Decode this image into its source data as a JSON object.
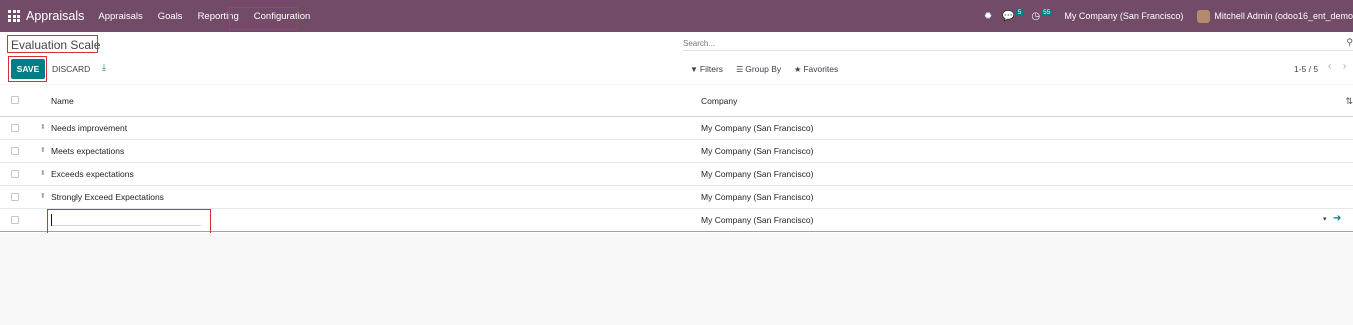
{
  "navbar": {
    "app_name": "Appraisals",
    "menu": [
      "Appraisals",
      "Goals",
      "Reporting",
      "Configuration"
    ],
    "messages_badge": "5",
    "activities_badge": "55",
    "company": "My Company (San Francisco)",
    "user": "Mitchell Admin (odoo16_ent_demo"
  },
  "control": {
    "title": "Evaluation Scale",
    "save_label": "SAVE",
    "discard_label": "DISCARD",
    "search_placeholder": "Search...",
    "filters_label": "Filters",
    "groupby_label": "Group By",
    "favorites_label": "Favorites",
    "pager": "1-5 / 5"
  },
  "list": {
    "columns": {
      "name": "Name",
      "company": "Company"
    },
    "rows": [
      {
        "name": "Needs improvement",
        "company": "My Company (San Francisco)"
      },
      {
        "name": "Meets expectations",
        "company": "My Company (San Francisco)"
      },
      {
        "name": "Exceeds expectations",
        "company": "My Company (San Francisco)"
      },
      {
        "name": "Strongly Exceed Expectations",
        "company": "My Company (San Francisco)"
      }
    ],
    "edit_row": {
      "name": "",
      "company": "My Company (San Francisco)"
    }
  },
  "icons": {
    "apps": "apps-grid-icon",
    "bug": "bug-icon",
    "chat": "chat-icon",
    "clock": "clock-icon",
    "download": "download-icon",
    "search": "search-icon",
    "filter": "filter-icon",
    "groupby": "layers-icon",
    "favorites": "star-icon"
  },
  "colors": {
    "navbar": "#714b67",
    "primary": "#017e84",
    "highlight": "#d0323a"
  }
}
